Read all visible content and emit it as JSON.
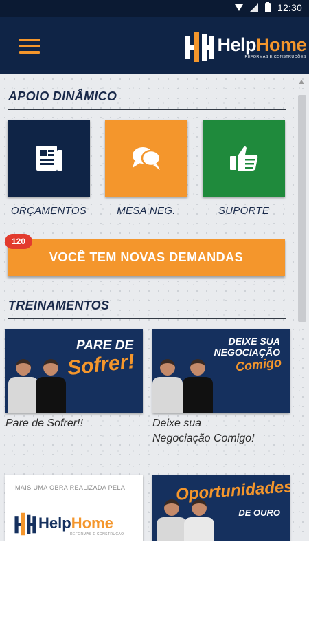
{
  "status_bar": {
    "time": "12:30"
  },
  "header": {
    "menu_icon": "hamburger-menu-icon",
    "brand_help": "Help",
    "brand_home": "Home",
    "brand_tagline": "REFORMAS E CONSTRUÇÕES"
  },
  "apoio": {
    "title": "APOIO DINÂMICO",
    "tiles": [
      {
        "label": "ORÇAMENTOS",
        "icon": "document-icon",
        "color": "#0f2446"
      },
      {
        "label": "MESA NEG.",
        "icon": "chat-bubbles-icon",
        "color": "#f4962c"
      },
      {
        "label": "SUPORTE",
        "icon": "thumbs-up-icon",
        "color": "#1f8a3c"
      }
    ]
  },
  "demandas": {
    "badge": "120",
    "label": "VOCÊ TEM NOVAS DEMANDAS"
  },
  "treinamentos": {
    "title": "TREINAMENTOS",
    "cards": [
      {
        "art_line1": "PARE DE",
        "art_line2": "Sofrer!",
        "caption": "Pare de Sofrer!!"
      },
      {
        "art_line1": "DEIXE SUA",
        "art_line2": "NEGOCIAÇÃO",
        "art_line3": "Comigo",
        "caption_line1": "Deixe sua",
        "caption_line2": "Negociação Comigo!"
      },
      {
        "art_top": "MAIS UMA OBRA REALIZADA PELA",
        "brand_help": "Help",
        "brand_home": "Home",
        "brand_tagline": "REFORMAS E CONSTRUÇÃO"
      },
      {
        "art_line1": "Oportunidades",
        "art_line2": "DE OURO"
      }
    ]
  },
  "colors": {
    "navy": "#0f2446",
    "orange": "#f4962c",
    "green": "#1f8a3c",
    "badge_red": "#e23b2e"
  }
}
